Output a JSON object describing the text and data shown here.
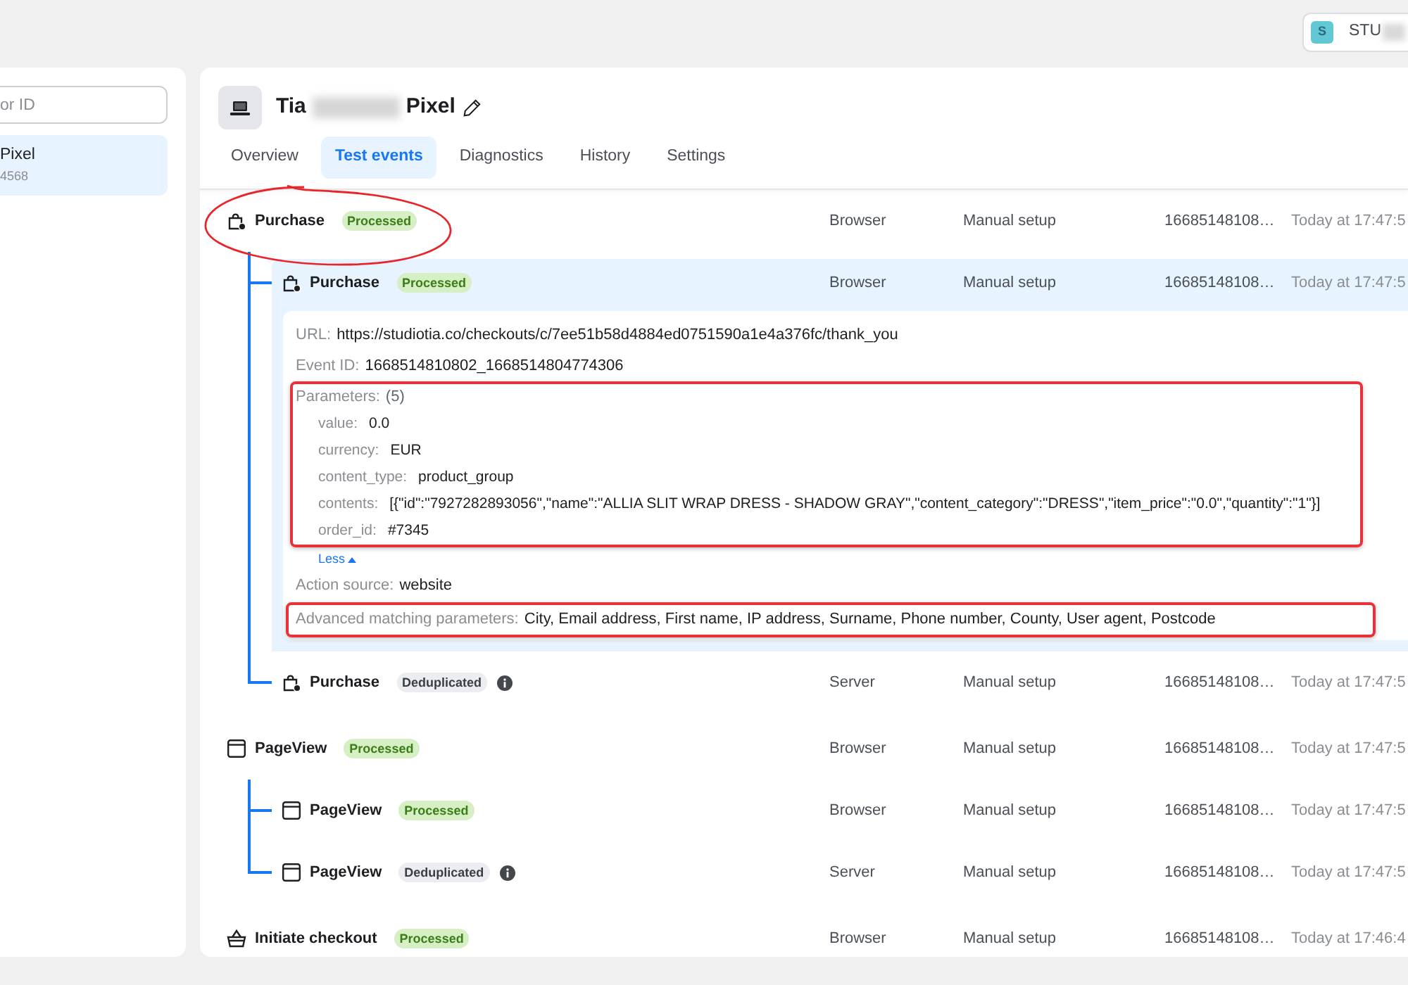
{
  "account": {
    "initial": "S",
    "name": "STU",
    "redacted": true
  },
  "sidebar": {
    "search": {
      "placeholder": "or ID"
    },
    "items": [
      {
        "title": "Pixel",
        "subtitle": "4568",
        "selected": true
      }
    ]
  },
  "pixel": {
    "title": [
      "Tia",
      "Pixel"
    ],
    "redacted": true
  },
  "tabs": [
    {
      "label": "Overview",
      "selected": false
    },
    {
      "label": "Test events",
      "selected": true
    },
    {
      "label": "Diagnostics",
      "selected": false
    },
    {
      "label": "History",
      "selected": false
    },
    {
      "label": "Settings",
      "selected": false
    }
  ],
  "events": [
    {
      "kind": "purchase",
      "name": "Purchase",
      "badge": {
        "label": "Processed",
        "kind": "processed"
      },
      "source": "Browser",
      "setup": "Manual setup",
      "id": "16685148108…",
      "time": "Today at 17:47:5",
      "annotated": true,
      "children": [
        {
          "kind": "purchase",
          "name": "Purchase",
          "badge": {
            "label": "Processed",
            "kind": "processed"
          },
          "source": "Browser",
          "setup": "Manual setup",
          "id": "16685148108…",
          "time": "Today at 17:47:5",
          "expanded": true,
          "details": {
            "url": {
              "label": "URL:",
              "value": "https://studiotia.co/checkouts/c/7ee51b58d4884ed0751590a1e4a376fc/thank_you"
            },
            "event_id": {
              "label": "Event ID:",
              "value": "1668514810802_1668514804774306"
            },
            "parameters": {
              "label": "Parameters:",
              "count": "(5)",
              "annotated": true,
              "items": [
                {
                  "key": "value:",
                  "value": "0.0"
                },
                {
                  "key": "currency:",
                  "value": "EUR"
                },
                {
                  "key": "content_type:",
                  "value": "product_group"
                },
                {
                  "key": "contents:",
                  "value": "[{\"id\":\"7927282893056\",\"name\":\"ALLIA SLIT WRAP DRESS - SHADOW GRAY\",\"content_category\":\"DRESS\",\"item_price\":\"0.0\",\"quantity\":\"1\"}]"
                },
                {
                  "key": "order_id:",
                  "value": "#7345"
                }
              ],
              "toggle": "Less"
            },
            "action_source": {
              "label": "Action source:",
              "value": "website"
            },
            "advanced_matching": {
              "label": "Advanced matching parameters:",
              "value": "City, Email address, First name, IP address, Surname, Phone number, County, User agent, Postcode",
              "annotated": true
            }
          }
        },
        {
          "kind": "purchase",
          "name": "Purchase",
          "badge": {
            "label": "Deduplicated",
            "kind": "deduplicated"
          },
          "source": "Server",
          "setup": "Manual setup",
          "id": "16685148108…",
          "time": "Today at 17:47:5",
          "expanded": false
        }
      ]
    },
    {
      "kind": "page_view",
      "name": "PageView",
      "badge": {
        "label": "Processed",
        "kind": "processed"
      },
      "source": "Browser",
      "setup": "Manual setup",
      "id": "16685148108…",
      "time": "Today at 17:47:5",
      "annotated": false,
      "children": [
        {
          "kind": "page_view",
          "name": "PageView",
          "badge": {
            "label": "Processed",
            "kind": "processed"
          },
          "source": "Browser",
          "setup": "Manual setup",
          "id": "16685148108…",
          "time": "Today at 17:47:5",
          "expanded": false
        },
        {
          "kind": "page_view",
          "name": "PageView",
          "badge": {
            "label": "Deduplicated",
            "kind": "deduplicated"
          },
          "source": "Server",
          "setup": "Manual setup",
          "id": "16685148108…",
          "time": "Today at 17:47:5",
          "expanded": false
        }
      ]
    },
    {
      "kind": "initiate_checkout",
      "name": "Initiate checkout",
      "badge": {
        "label": "Processed",
        "kind": "processed"
      },
      "source": "Browser",
      "setup": "Manual setup",
      "id": "16685148108…",
      "time": "Today at 17:46:4",
      "annotated": false
    }
  ]
}
